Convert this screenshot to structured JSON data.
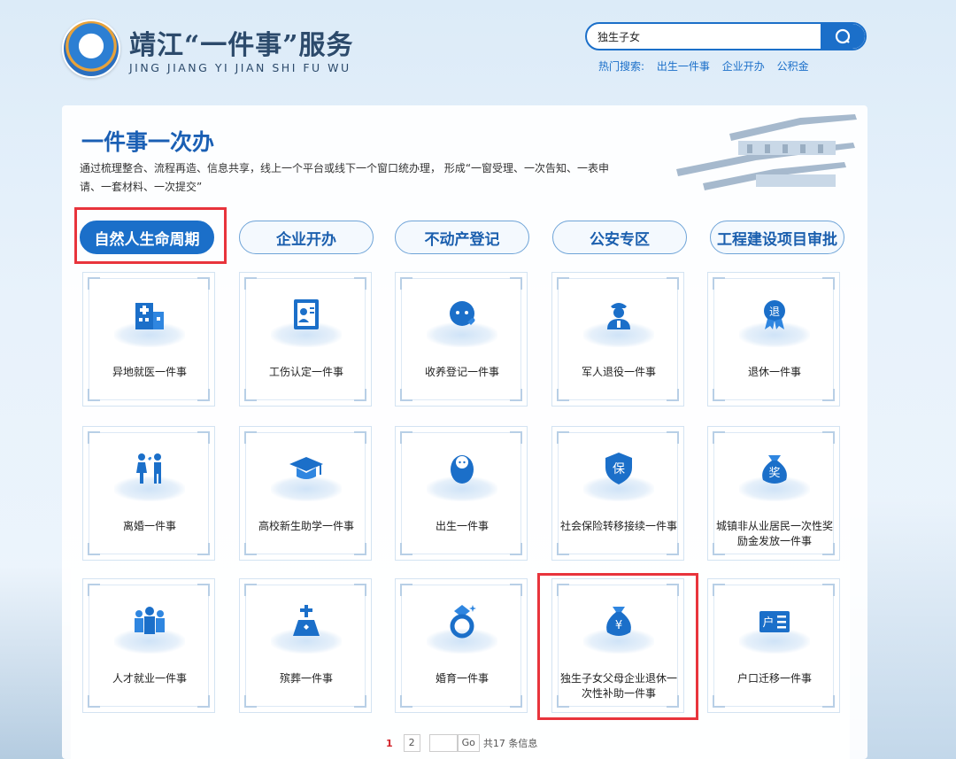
{
  "header": {
    "title": "靖江“一件事”服务",
    "subtitle": "JING JIANG YI JIAN SHI FU WU",
    "search_value": "独生子女",
    "hot_label": "热门搜索:",
    "hot_items": [
      "出生一件事",
      "企业开办",
      "公积金"
    ]
  },
  "intro": {
    "title": "一件事一次办",
    "desc": "通过梳理整合、流程再造、信息共享，线上一个平台或线下一个窗口统办理， 形成“一窗受理、一次告知、一表申请、一套材料、一次提交”"
  },
  "tabs": [
    "自然人生命周期",
    "企业开办",
    "不动产登记",
    "公安专区",
    "工程建设项目审批"
  ],
  "active_tab": "自然人生命周期",
  "items": [
    {
      "label": "异地就医一件事",
      "icon": "hospital-icon"
    },
    {
      "label": "工伤认定一件事",
      "icon": "id-card-icon"
    },
    {
      "label": "收养登记一件事",
      "icon": "baby-icon"
    },
    {
      "label": "军人退役一件事",
      "icon": "soldier-icon"
    },
    {
      "label": "退休一件事",
      "icon": "retire-badge-icon"
    },
    {
      "label": "离婚一件事",
      "icon": "couple-icon"
    },
    {
      "label": "高校新生助学一件事",
      "icon": "graduation-cap-icon"
    },
    {
      "label": "出生一件事",
      "icon": "newborn-icon"
    },
    {
      "label": "社会保险转移接续一件事",
      "icon": "insurance-shield-icon"
    },
    {
      "label": "城镇非从业居民一次性奖励金发放一件事",
      "icon": "reward-bag-icon"
    },
    {
      "label": "人才就业一件事",
      "icon": "group-icon"
    },
    {
      "label": "殡葬一件事",
      "icon": "funeral-icon"
    },
    {
      "label": "婚育一件事",
      "icon": "ring-icon"
    },
    {
      "label": "独生子女父母企业退休一次性补助一件事",
      "icon": "money-bag-icon"
    },
    {
      "label": "户口迁移一件事",
      "icon": "household-icon"
    }
  ],
  "pager": {
    "current": "1",
    "next": "2",
    "go": "Go",
    "total": "共17 条信息"
  },
  "colors": {
    "primary": "#1b6fc9",
    "highlight": "#e8343c",
    "title": "#2c4a6b"
  }
}
